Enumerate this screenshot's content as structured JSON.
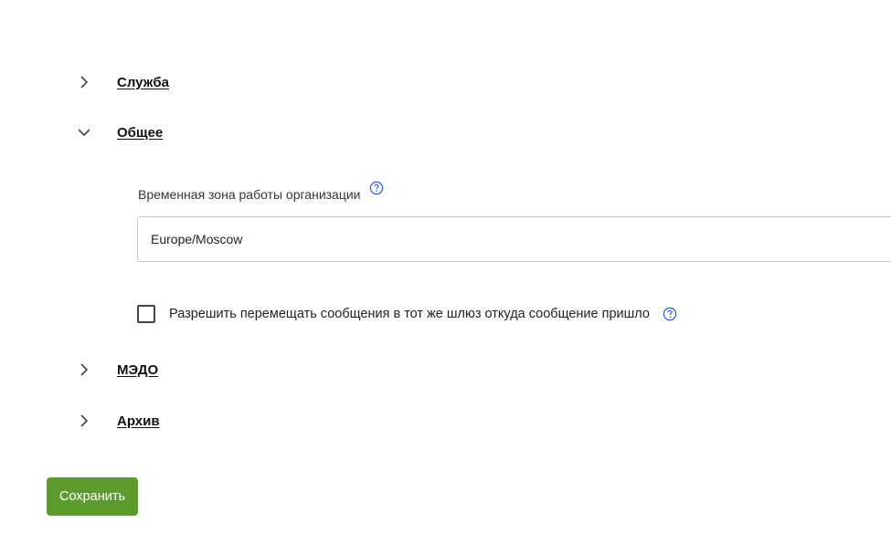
{
  "sections": [
    {
      "title": "Служба",
      "state": "collapsed",
      "icon": "chevron-right-icon"
    },
    {
      "title": "Общее",
      "state": "expanded",
      "icon": "chevron-down-icon"
    },
    {
      "title": "МЭДО",
      "state": "collapsed",
      "icon": "chevron-right-icon"
    },
    {
      "title": "Архив",
      "state": "collapsed",
      "icon": "chevron-right-icon"
    }
  ],
  "general": {
    "timezone_label": "Временная зона работы организации",
    "timezone_value": "Europe/Moscow",
    "allow_same_gateway_label": "Разрешить перемещать сообщения в тот же шлюз откуда сообщение пришло",
    "allow_same_gateway_checked": false,
    "help_icon": "help-circle-icon"
  },
  "actions": {
    "save_label": "Сохранить"
  },
  "colors": {
    "accent_green": "#5e9b2f",
    "icon_blue": "#2b5dd6",
    "text": "#222222"
  }
}
